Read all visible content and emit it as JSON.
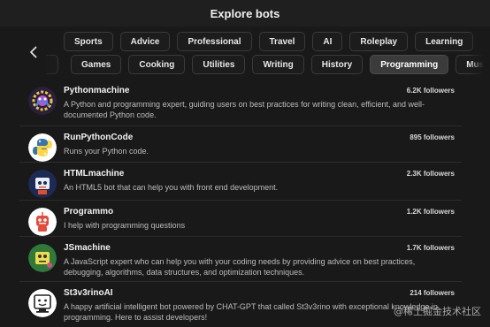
{
  "header": {
    "title": "Explore bots"
  },
  "categories": {
    "row1": [
      "Sports",
      "Advice",
      "Professional",
      "Travel",
      "AI",
      "Roleplay",
      "Learning"
    ],
    "row2": [
      "Games",
      "Cooking",
      "Utilities",
      "Writing",
      "History",
      "Programming",
      "Music"
    ],
    "active": "Programming"
  },
  "bots": [
    {
      "name": "Pythonmachine",
      "followers": "6.2K followers",
      "description": "A Python and programming expert, guiding users on best practices for writing clean, efficient, and well-documented Python code.",
      "avatar": "python-gear-icon"
    },
    {
      "name": "RunPythonCode",
      "followers": "895 followers",
      "description": "Runs your Python code.",
      "avatar": "python-logo-icon"
    },
    {
      "name": "HTMLmachine",
      "followers": "2.3K followers",
      "description": "An HTML5 bot that can help you with front end development.",
      "avatar": "html-robot-icon"
    },
    {
      "name": "Programmo",
      "followers": "1.2K followers",
      "description": "I help with programming questions",
      "avatar": "robot-icon"
    },
    {
      "name": "JSmachine",
      "followers": "1.7K followers",
      "description": "A JavaScript expert who can help you with your coding needs by providing advice on best practices, debugging, algorithms, data structures, and optimization techniques.",
      "avatar": "js-robot-icon"
    },
    {
      "name": "St3v3rinoAI",
      "followers": "214 followers",
      "description": "A happy artificial intelligent bot powered by CHAT-GPT that called St3v3rino with exceptional knowledge in programming. Here to assist developers!",
      "avatar": "computer-face-icon"
    }
  ],
  "watermark": "@稀土掘金技术社区",
  "colors": {
    "background": "#191919",
    "chip_border": "#3a3a3a",
    "chip_active": "#3b3b3b"
  }
}
